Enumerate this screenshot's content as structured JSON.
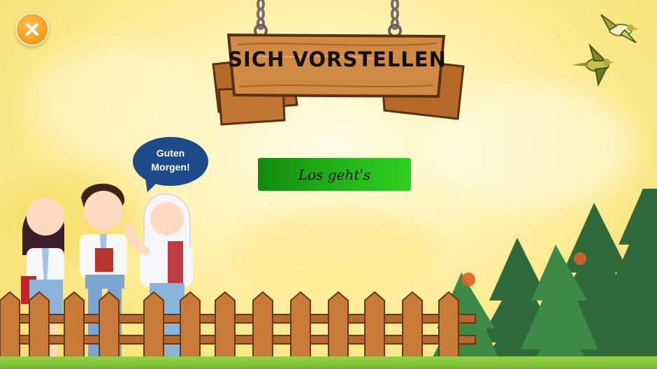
{
  "sign": {
    "title": "SICH VORSTELLEN"
  },
  "start_button": {
    "label": "Los geht's"
  },
  "speech_bubble": {
    "line1": "Guten",
    "line2": "Morgen!"
  },
  "icons": {
    "close": "close-icon"
  },
  "colors": {
    "close_button": "#f7a11a",
    "start_button": "#1fa915",
    "bubble": "#1f4a8a",
    "wood": "#c77a34"
  }
}
